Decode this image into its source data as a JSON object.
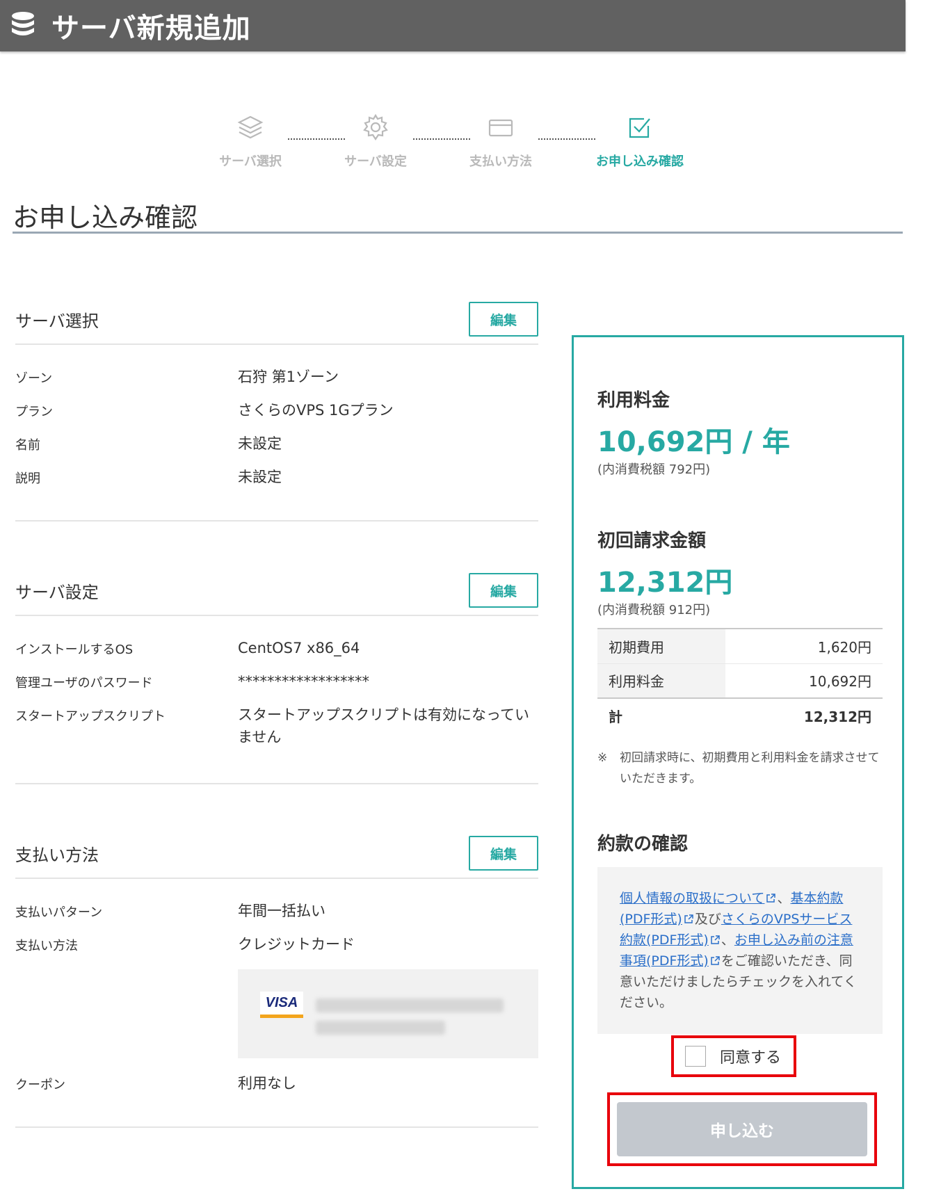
{
  "window": {
    "title": "サーバ新規追加"
  },
  "stepper": {
    "steps": [
      {
        "label": "サーバ選択"
      },
      {
        "label": "サーバ設定"
      },
      {
        "label": "支払い方法"
      },
      {
        "label": "お申し込み確認"
      }
    ]
  },
  "page": {
    "title": "お申し込み確認"
  },
  "sections": {
    "server_select": {
      "heading": "サーバ選択",
      "edit_label": "編集",
      "rows": [
        {
          "key": "ゾーン",
          "value": "石狩 第1ゾーン"
        },
        {
          "key": "プラン",
          "value": "さくらのVPS 1Gプラン"
        },
        {
          "key": "名前",
          "value": "未設定"
        },
        {
          "key": "説明",
          "value": "未設定"
        }
      ]
    },
    "server_settings": {
      "heading": "サーバ設定",
      "edit_label": "編集",
      "rows": [
        {
          "key": "インストールするOS",
          "value": "CentOS7 x86_64"
        },
        {
          "key": "管理ユーザのパスワード",
          "value": "******************"
        },
        {
          "key": "スタートアップスクリプト",
          "value": "スタートアップスクリプトは有効になっていません"
        }
      ]
    },
    "payment": {
      "heading": "支払い方法",
      "edit_label": "編集",
      "rows": [
        {
          "key": "支払いパターン",
          "value": "年間一括払い"
        },
        {
          "key": "支払い方法",
          "value": "クレジットカード"
        }
      ],
      "card_brand": "VISA",
      "coupon": {
        "key": "クーポン",
        "value": "利用なし"
      }
    }
  },
  "summary": {
    "usage_fee_heading": "利用料金",
    "usage_fee_amount": "10,692円 / 年",
    "usage_fee_tax": "(内消費税額 792円)",
    "first_bill_heading": "初回請求金額",
    "first_bill_amount": "12,312円",
    "first_bill_tax": "(内消費税額 912円)",
    "breakdown": [
      {
        "key": "初期費用",
        "value": "1,620円"
      },
      {
        "key": "利用料金",
        "value": "10,692円"
      }
    ],
    "total": {
      "key": "計",
      "value": "12,312円"
    },
    "note_mark": "※",
    "note": "初回請求時に、初期費用と利用料金を請求させていただきます。",
    "terms_heading": "約款の確認",
    "terms": {
      "link1": "個人情報の取扱について",
      "sep1": "、",
      "link2": "基本約款(PDF形式)",
      "sep2": "及び",
      "link3": "さくらのVPSサービス約款(PDF形式)",
      "sep3": "、",
      "link4": "お申し込み前の注意事項(PDF形式)",
      "tail": "をご確認いただき、同意いただけましたらチェックを入れてください。"
    },
    "agree_label": "同意する",
    "submit_label": "申し込む"
  },
  "colors": {
    "accent": "#27a9a3",
    "highlight": "#e8000b",
    "link": "#2b6fc9",
    "titlebar": "#616161"
  }
}
